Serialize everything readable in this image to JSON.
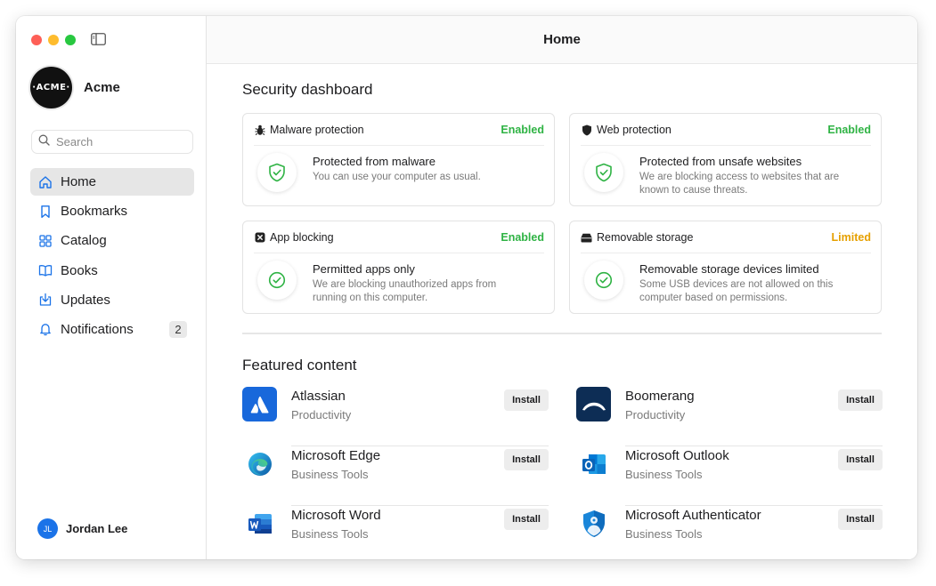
{
  "window": {
    "title": "Home"
  },
  "sidebar": {
    "brand": {
      "logo_text": "·ACME·",
      "name": "Acme"
    },
    "search": {
      "placeholder": "Search",
      "icon": "search-icon"
    },
    "items": [
      {
        "label": "Home",
        "icon": "home-icon",
        "active": true
      },
      {
        "label": "Bookmarks",
        "icon": "bookmark-icon"
      },
      {
        "label": "Catalog",
        "icon": "grid-icon"
      },
      {
        "label": "Books",
        "icon": "book-icon"
      },
      {
        "label": "Updates",
        "icon": "download-tray-icon"
      },
      {
        "label": "Notifications",
        "icon": "bell-icon",
        "badge": "2"
      }
    ],
    "user": {
      "initials": "JL",
      "name": "Jordan Lee"
    }
  },
  "dashboard": {
    "title": "Security dashboard",
    "cards": [
      {
        "name": "Malware protection",
        "icon": "bug-icon",
        "status": "Enabled",
        "title": "Protected from malware",
        "desc": "You can use your computer as usual."
      },
      {
        "name": "Web protection",
        "icon": "shield-icon",
        "status": "Enabled",
        "title": "Protected from unsafe websites",
        "desc": "We are blocking access to websites that are known to cause threats."
      },
      {
        "name": "App blocking",
        "icon": "blocked-app-icon",
        "status": "Enabled",
        "title": "Permitted apps only",
        "desc": "We are blocking unauthorized apps from running on this computer."
      },
      {
        "name": "Removable storage",
        "icon": "drive-icon",
        "status": "Limited",
        "title": "Removable storage devices limited",
        "desc": "Some USB devices are not allowed on this computer based on permissions."
      }
    ]
  },
  "featured": {
    "title": "Featured content",
    "install_label": "Install",
    "apps": [
      {
        "name": "Atlassian",
        "category": "Productivity",
        "icon": "atlassian-icon"
      },
      {
        "name": "Boomerang",
        "category": "Productivity",
        "icon": "boomerang-icon"
      },
      {
        "name": "Microsoft Edge",
        "category": "Business Tools",
        "icon": "edge-icon"
      },
      {
        "name": "Microsoft Outlook",
        "category": "Business Tools",
        "icon": "outlook-icon"
      },
      {
        "name": "Microsoft Word",
        "category": "Business Tools",
        "icon": "word-icon"
      },
      {
        "name": "Microsoft Authenticator",
        "category": "Business Tools",
        "icon": "authenticator-icon"
      }
    ]
  },
  "colors": {
    "enabled": "#2fb344",
    "limited": "#e6a000",
    "accent": "#1b73e8"
  }
}
